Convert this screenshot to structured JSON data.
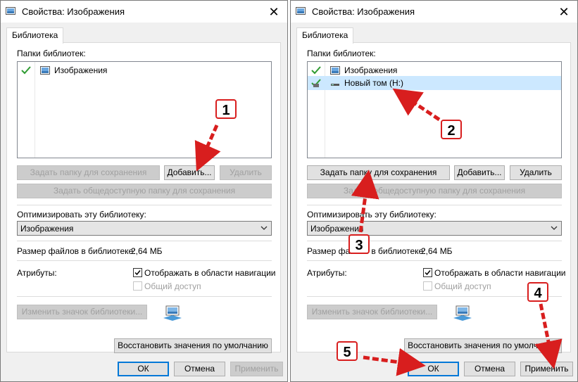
{
  "left_window": {
    "title": "Свойства: Изображения",
    "tab": "Библиотека",
    "folders_label": "Папки библиотек:",
    "folders": [
      {
        "name": "Изображения",
        "selected": false,
        "icon": "pictures-icon",
        "status": "check"
      }
    ],
    "buttons": {
      "set_save_folder": "Задать папку для сохранения",
      "add": "Добавить...",
      "remove": "Удалить",
      "set_public_folder": "Задать общедоступную папку для сохранения"
    },
    "optimize_label": "Оптимизировать эту библиотеку:",
    "optimize_value": "Изображения",
    "size_label": "Размер файлов в библиотеке:",
    "size_value": "2,64 МБ",
    "attributes_label": "Атрибуты:",
    "show_in_nav": {
      "label": "Отображать в области навигации",
      "checked": true
    },
    "shared": {
      "label": "Общий доступ",
      "checked": false
    },
    "change_icon": "Изменить значок библиотеки...",
    "restore_defaults": "Восстановить значения по умолчанию",
    "ok": "ОК",
    "cancel": "Отмена",
    "apply": "Применить"
  },
  "right_window": {
    "title": "Свойства: Изображения",
    "tab": "Библиотека",
    "folders_label": "Папки библиотек:",
    "folders": [
      {
        "name": "Изображения",
        "selected": false,
        "icon": "pictures-icon",
        "status": "check"
      },
      {
        "name": "Новый том (H:)",
        "selected": true,
        "icon": "drive-icon",
        "status": "save-location"
      }
    ],
    "buttons": {
      "set_save_folder": "Задать папку для сохранения",
      "add": "Добавить...",
      "remove": "Удалить",
      "set_public_folder": "Задать общедоступную папку для сохранения"
    },
    "optimize_label": "Оптимизировать эту библиотеку:",
    "optimize_value": "Изображения",
    "size_label": "Размер файлов в библиотеке:",
    "size_value": "2,64 МБ",
    "attributes_label": "Атрибуты:",
    "show_in_nav": {
      "label": "Отображать в области навигации",
      "checked": true
    },
    "shared": {
      "label": "Общий доступ",
      "checked": false
    },
    "change_icon": "Изменить значок библиотеки...",
    "restore_defaults": "Восстановить значения по умолчанию",
    "ok": "ОК",
    "cancel": "Отмена",
    "apply": "Применить"
  },
  "annotations": [
    "1",
    "2",
    "3",
    "4",
    "5"
  ],
  "colors": {
    "annotation": "#d81e1e",
    "selection": "#cce8ff",
    "focus": "#0078d7"
  }
}
